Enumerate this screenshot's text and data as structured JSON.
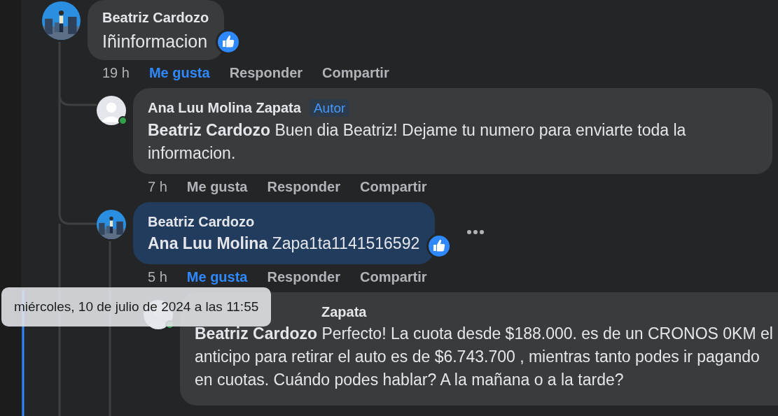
{
  "comments": [
    {
      "author": "Beatriz Cardozo",
      "photo_avatar": true,
      "online": false,
      "highlighted": false,
      "text": "Iñinformacion",
      "reacted": true,
      "more_menu": false,
      "time": "19 h",
      "actions": [
        {
          "label": "Me gusta",
          "active": true
        },
        {
          "label": "Responder",
          "active": false
        },
        {
          "label": "Compartir",
          "active": false
        }
      ],
      "replies": [
        {
          "author": "Ana Luu Molina Zapata",
          "badge": "Autor",
          "photo_avatar": false,
          "online": true,
          "highlighted": false,
          "text": "**Beatriz Cardozo** Buen dia Beatriz! Dejame tu numero para enviarte toda la informacion.",
          "reacted": false,
          "more_menu": false,
          "time": "7 h",
          "actions": [
            {
              "label": "Me gusta",
              "active": false
            },
            {
              "label": "Responder",
              "active": false
            },
            {
              "label": "Compartir",
              "active": false
            }
          ]
        },
        {
          "author": "Beatriz Cardozo",
          "photo_avatar": true,
          "online": false,
          "highlighted": true,
          "text": "**Ana Luu Molina** Zapa1ta1141516592",
          "reacted": true,
          "more_menu": true,
          "time": "5 h",
          "actions": [
            {
              "label": "Me gusta",
              "active": true
            },
            {
              "label": "Responder",
              "active": false
            },
            {
              "label": "Compartir",
              "active": false
            }
          ],
          "replies": [
            {
              "author": "Zapata",
              "photo_avatar": false,
              "online": true,
              "highlighted": false,
              "text": "**Beatriz Cardozo** Perfecto! La cuota desde $188.000. es de un CRONOS 0KM el anticipo para retirar el auto es de $6.743.700 , mientras tanto podes ir pagando en cuotas. Cuándo podes hablar? A la mañana o a la tarde?",
              "reacted": false,
              "more_menu": false
            }
          ]
        }
      ]
    }
  ],
  "tooltip": {
    "text": "miércoles, 10 de julio de 2024 a las 11:55"
  }
}
